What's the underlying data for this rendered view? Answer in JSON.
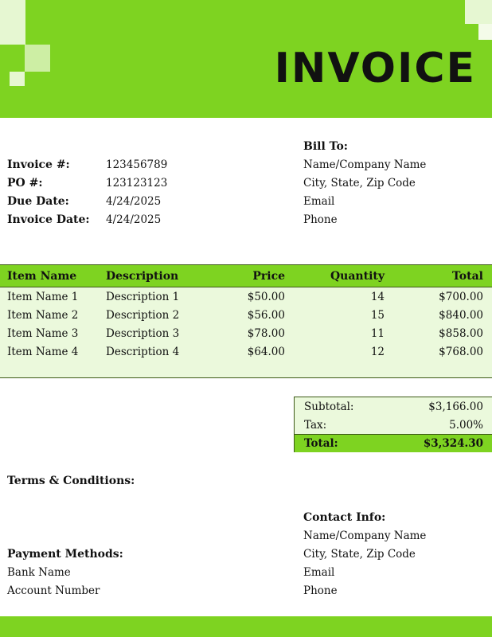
{
  "title": "INVOICE",
  "bill_to": {
    "heading": "Bill To:",
    "name": "Name/Company Name",
    "address": "City, State, Zip Code",
    "email": "Email",
    "phone": "Phone"
  },
  "meta": [
    {
      "label": "Invoice #:",
      "value": "123456789"
    },
    {
      "label": "PO #:",
      "value": "123123123"
    },
    {
      "label": "Due Date:",
      "value": "4/24/2025"
    },
    {
      "label": "Invoice Date:",
      "value": "4/24/2025"
    }
  ],
  "items_table": {
    "headers": {
      "name": "Item Name",
      "description": "Description",
      "price": "Price",
      "quantity": "Quantity",
      "total": "Total"
    },
    "rows": [
      {
        "name": "Item Name 1",
        "description": "Description 1",
        "price": "$50.00",
        "quantity": "14",
        "total": "$700.00"
      },
      {
        "name": "Item Name 2",
        "description": "Description 2",
        "price": "$56.00",
        "quantity": "15",
        "total": "$840.00"
      },
      {
        "name": "Item Name 3",
        "description": "Description 3",
        "price": "$78.00",
        "quantity": "11",
        "total": "$858.00"
      },
      {
        "name": "Item Name 4",
        "description": "Description 4",
        "price": "$64.00",
        "quantity": "12",
        "total": "$768.00"
      }
    ]
  },
  "summary": {
    "subtotal_label": "Subtotal:",
    "subtotal": "$3,166.00",
    "tax_label": "Tax:",
    "tax": "5.00%",
    "total_label": "Total:",
    "total": "$3,324.30"
  },
  "terms": {
    "heading": "Terms & Conditions:"
  },
  "contact": {
    "heading": "Contact Info:",
    "name": "Name/Company Name",
    "address": "City, State, Zip Code",
    "email": "Email",
    "phone": "Phone"
  },
  "payment": {
    "heading": "Payment Methods:",
    "bank": "Bank Name",
    "account": "Account Number"
  },
  "colors": {
    "accent": "#7ed321",
    "light": "#ebf9dc",
    "border": "#3d5a16"
  }
}
